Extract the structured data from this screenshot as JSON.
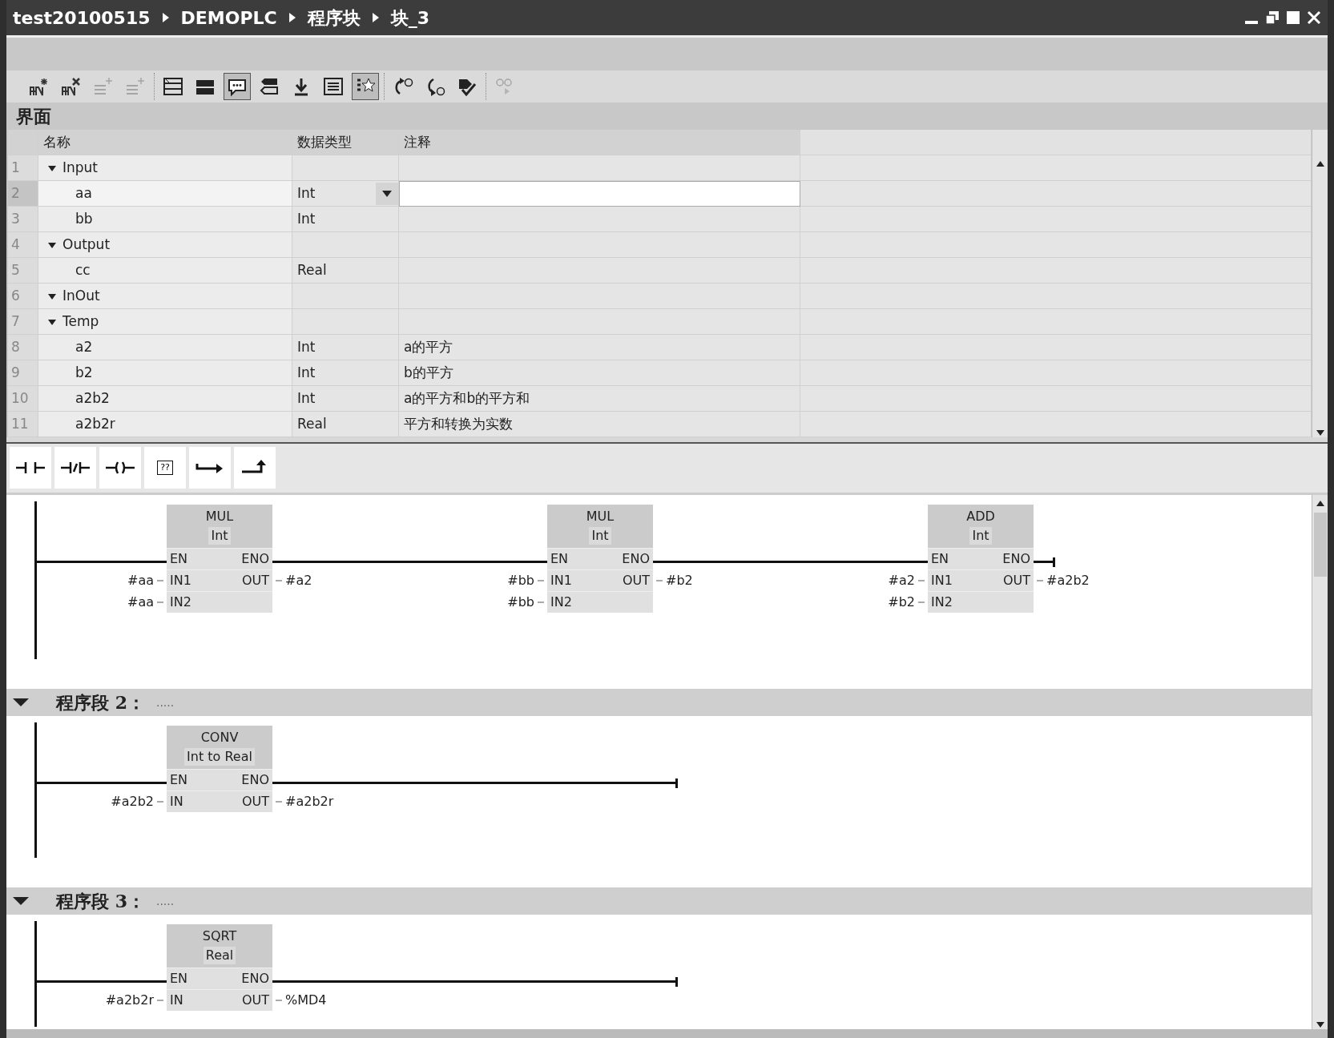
{
  "window": {
    "breadcrumb": [
      "test20100515",
      "DEMOPLC",
      "程序块",
      "块_3"
    ]
  },
  "toolbar": [
    [
      {
        "kind": "insert-network",
        "disabled": false,
        "selected": false
      },
      {
        "kind": "delete-network",
        "disabled": false,
        "selected": false
      },
      {
        "kind": "insert-row",
        "disabled": true,
        "selected": false
      },
      {
        "kind": "append-row",
        "disabled": true,
        "selected": false
      }
    ],
    [
      {
        "kind": "collapse",
        "disabled": false,
        "selected": false
      },
      {
        "kind": "expand",
        "disabled": false,
        "selected": false
      },
      {
        "kind": "comment",
        "disabled": false,
        "selected": true
      },
      {
        "kind": "operand",
        "disabled": false,
        "selected": false
      },
      {
        "kind": "download",
        "disabled": false,
        "selected": false
      },
      {
        "kind": "list",
        "disabled": false,
        "selected": false
      },
      {
        "kind": "favorites",
        "disabled": false,
        "selected": true
      }
    ],
    [
      {
        "kind": "prev-error",
        "disabled": false,
        "selected": false
      },
      {
        "kind": "next-error",
        "disabled": false,
        "selected": false
      },
      {
        "kind": "update",
        "disabled": false,
        "selected": false
      }
    ],
    [
      {
        "kind": "monitor",
        "disabled": true,
        "selected": false
      }
    ]
  ],
  "interface": {
    "title": "界面",
    "columns": [
      "名称",
      "数据类型",
      "注释"
    ],
    "rows": [
      {
        "number": "1",
        "name": "Input",
        "expanded": true,
        "selected": false,
        "children": [
          {
            "number": "2",
            "name": "aa",
            "data_type": "Int",
            "selected": true
          },
          {
            "number": "3",
            "name": "bb",
            "data_type": "Int",
            "selected": false
          }
        ]
      },
      {
        "number": "4",
        "name": "Output",
        "expanded": true,
        "selected": false,
        "children": [
          {
            "number": "5",
            "name": "cc",
            "data_type": "Real",
            "selected": false
          }
        ]
      },
      {
        "number": "6",
        "name": "InOut",
        "expanded": true,
        "selected": false
      },
      {
        "number": "7",
        "name": "Temp",
        "expanded": true,
        "selected": false,
        "children": [
          {
            "number": "8",
            "name": "a2",
            "data_type": "Int",
            "comment": "a的平方",
            "selected": false
          },
          {
            "number": "9",
            "name": "b2",
            "data_type": "Int",
            "comment": "b的平方",
            "selected": false
          },
          {
            "number": "10",
            "name": "a2b2",
            "data_type": "Int",
            "comment": "a的平方和b的平方和",
            "selected": false
          },
          {
            "number": "11",
            "name": "a2b2r",
            "data_type": "Real",
            "comment": "平方和转换为实数",
            "selected": false
          }
        ]
      }
    ]
  },
  "instructions": [
    {
      "kind": "no-contact"
    },
    {
      "kind": "nc-contact"
    },
    {
      "kind": "coil"
    },
    {
      "kind": "empty-box",
      "label": "??"
    },
    {
      "kind": "open-branch"
    },
    {
      "kind": "close-branch"
    }
  ],
  "networks": [
    {
      "boxes": [
        {
          "name": "MUL",
          "type": "Int",
          "inputs": [
            {
              "pin": "EN"
            },
            {
              "pin": "IN1",
              "operand": "#aa"
            },
            {
              "pin": "IN2",
              "operand": "#aa"
            }
          ],
          "outputs": [
            {
              "pin": "ENO"
            },
            {
              "pin": "OUT",
              "operand": "#a2"
            }
          ]
        },
        {
          "name": "MUL",
          "type": "Int",
          "inputs": [
            {
              "pin": "EN"
            },
            {
              "pin": "IN1",
              "operand": "#bb"
            },
            {
              "pin": "IN2",
              "operand": "#bb"
            }
          ],
          "outputs": [
            {
              "pin": "ENO"
            },
            {
              "pin": "OUT",
              "operand": "#b2"
            }
          ]
        },
        {
          "name": "ADD",
          "type": "Int",
          "inputs": [
            {
              "pin": "EN"
            },
            {
              "pin": "IN1",
              "operand": "#a2"
            },
            {
              "pin": "IN2",
              "operand": "#b2"
            }
          ],
          "outputs": [
            {
              "pin": "ENO"
            },
            {
              "pin": "OUT",
              "operand": "#a2b2"
            }
          ]
        }
      ]
    },
    {
      "title": "程序段 2：",
      "comment": ".....",
      "expanded": true,
      "boxes": [
        {
          "name": "CONV",
          "type": "Int to Real",
          "inputs": [
            {
              "pin": "EN"
            },
            {
              "pin": "IN",
              "operand": "#a2b2"
            }
          ],
          "outputs": [
            {
              "pin": "ENO"
            },
            {
              "pin": "OUT",
              "operand": "#a2b2r"
            }
          ]
        }
      ]
    },
    {
      "title": "程序段 3：",
      "comment": ".....",
      "expanded": true,
      "boxes": [
        {
          "name": "SQRT",
          "type": "Real",
          "inputs": [
            {
              "pin": "EN"
            },
            {
              "pin": "IN",
              "operand": "#a2b2r"
            }
          ],
          "outputs": [
            {
              "pin": "ENO"
            },
            {
              "pin": "OUT",
              "operand": "%MD4"
            }
          ]
        }
      ]
    }
  ]
}
